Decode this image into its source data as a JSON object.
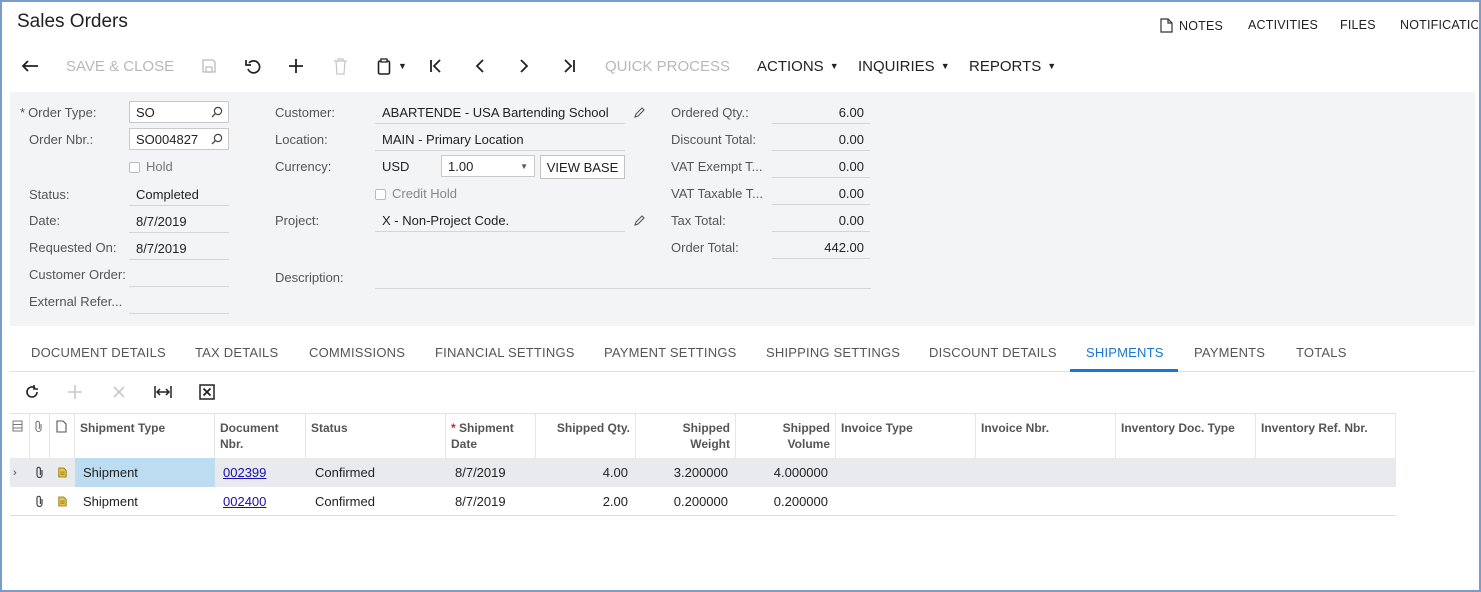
{
  "header": {
    "title": "Sales Orders",
    "links": [
      "NOTES",
      "ACTIVITIES",
      "FILES",
      "NOTIFICATIONS"
    ]
  },
  "toolbar": {
    "save_close": "SAVE & CLOSE",
    "quick_process": "QUICK PROCESS",
    "actions": "ACTIONS",
    "inquiries": "INQUIRIES",
    "reports": "REPORTS"
  },
  "form": {
    "order_type_label": "Order Type:",
    "order_type": "SO",
    "order_nbr_label": "Order Nbr.:",
    "order_nbr": "SO004827",
    "hold_label": "Hold",
    "status_label": "Status:",
    "status": "Completed",
    "date_label": "Date:",
    "date": "8/7/2019",
    "requested_on_label": "Requested On:",
    "requested_on": "8/7/2019",
    "customer_order_label": "Customer Order:",
    "customer_order": "",
    "external_ref_label": "External Refer...",
    "external_ref": "",
    "customer_label": "Customer:",
    "customer": "ABARTENDE - USA Bartending School",
    "location_label": "Location:",
    "location": "MAIN - Primary Location",
    "currency_label": "Currency:",
    "currency": "USD",
    "rate": "1.00",
    "view_base": "VIEW BASE",
    "credit_hold_label": "Credit Hold",
    "project_label": "Project:",
    "project": "X - Non-Project Code.",
    "description_label": "Description:",
    "description": "",
    "ordered_qty_label": "Ordered Qty.:",
    "ordered_qty": "6.00",
    "discount_total_label": "Discount Total:",
    "discount_total": "0.00",
    "vat_exempt_label": "VAT Exempt T...",
    "vat_exempt": "0.00",
    "vat_taxable_label": "VAT Taxable T...",
    "vat_taxable": "0.00",
    "tax_total_label": "Tax Total:",
    "tax_total": "0.00",
    "order_total_label": "Order Total:",
    "order_total": "442.00"
  },
  "tabs": [
    "DOCUMENT DETAILS",
    "TAX DETAILS",
    "COMMISSIONS",
    "FINANCIAL SETTINGS",
    "PAYMENT SETTINGS",
    "SHIPPING SETTINGS",
    "DISCOUNT DETAILS",
    "SHIPMENTS",
    "PAYMENTS",
    "TOTALS"
  ],
  "active_tab": "SHIPMENTS",
  "grid": {
    "columns": [
      "Shipment Type",
      "Document Nbr.",
      "Status",
      "Shipment Date",
      "Shipped Qty.",
      "Shipped Weight",
      "Shipped Volume",
      "Invoice Type",
      "Invoice Nbr.",
      "Inventory Doc. Type",
      "Inventory Ref. Nbr."
    ],
    "rows": [
      {
        "shipment_type": "Shipment",
        "document_nbr": "002399",
        "status": "Confirmed",
        "shipment_date": "8/7/2019",
        "shipped_qty": "4.00",
        "shipped_weight": "3.200000",
        "shipped_volume": "4.000000",
        "invoice_type": "",
        "invoice_nbr": "",
        "inv_doc_type": "",
        "inv_ref_nbr": ""
      },
      {
        "shipment_type": "Shipment",
        "document_nbr": "002400",
        "status": "Confirmed",
        "shipment_date": "8/7/2019",
        "shipped_qty": "2.00",
        "shipped_weight": "0.200000",
        "shipped_volume": "0.200000",
        "invoice_type": "",
        "invoice_nbr": "",
        "inv_doc_type": "",
        "inv_ref_nbr": ""
      }
    ]
  },
  "colors": {
    "accent": "#1976d2",
    "selected_cell": "#bcdcf2",
    "row_highlight": "#e8eaee",
    "form_bg": "#f3f4f6",
    "link": "#1a0dab"
  }
}
